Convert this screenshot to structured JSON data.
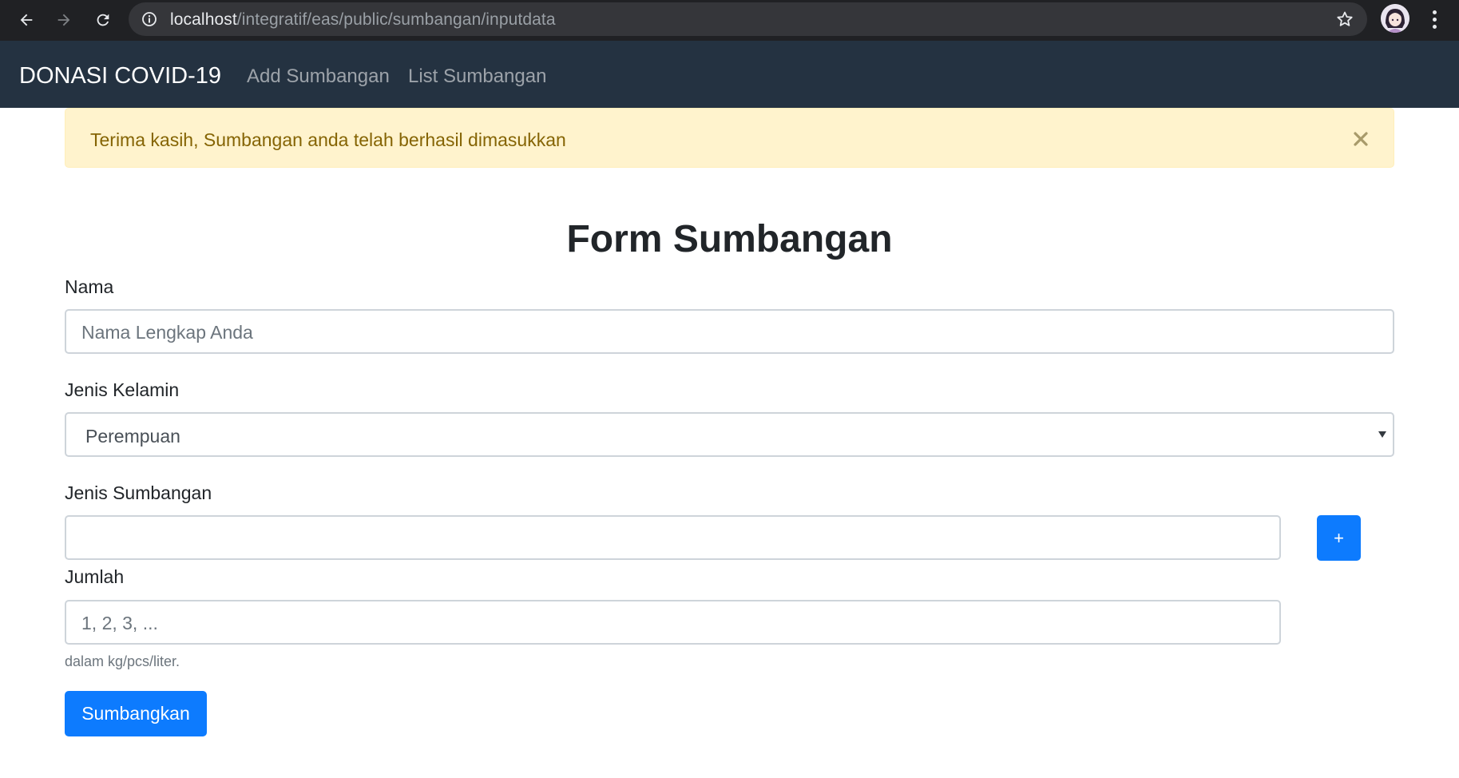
{
  "browser": {
    "url_host": "localhost",
    "url_path": "/integratif/eas/public/sumbangan/inputdata"
  },
  "navbar": {
    "brand": "DONASI COVID-19",
    "links": [
      "Add Sumbangan",
      "List Sumbangan"
    ]
  },
  "alert": {
    "message": "Terima kasih, Sumbangan anda telah berhasil dimasukkan"
  },
  "form": {
    "title": "Form Sumbangan",
    "nama": {
      "label": "Nama",
      "placeholder": "Nama Lengkap Anda",
      "value": ""
    },
    "jenis_kelamin": {
      "label": "Jenis Kelamin",
      "selected": "Perempuan"
    },
    "jenis_sumbangan": {
      "label": "Jenis Sumbangan",
      "value": "",
      "add_label": "+"
    },
    "jumlah": {
      "label": "Jumlah",
      "placeholder": "1, 2, 3, ...",
      "help": "dalam kg/pcs/liter."
    },
    "submit_label": "Sumbangkan"
  },
  "colors": {
    "chrome_bg": "#202124",
    "navbar_bg": "#243241",
    "alert_bg": "#fff3cd",
    "alert_text": "#856404",
    "primary": "#0d7bfe"
  }
}
